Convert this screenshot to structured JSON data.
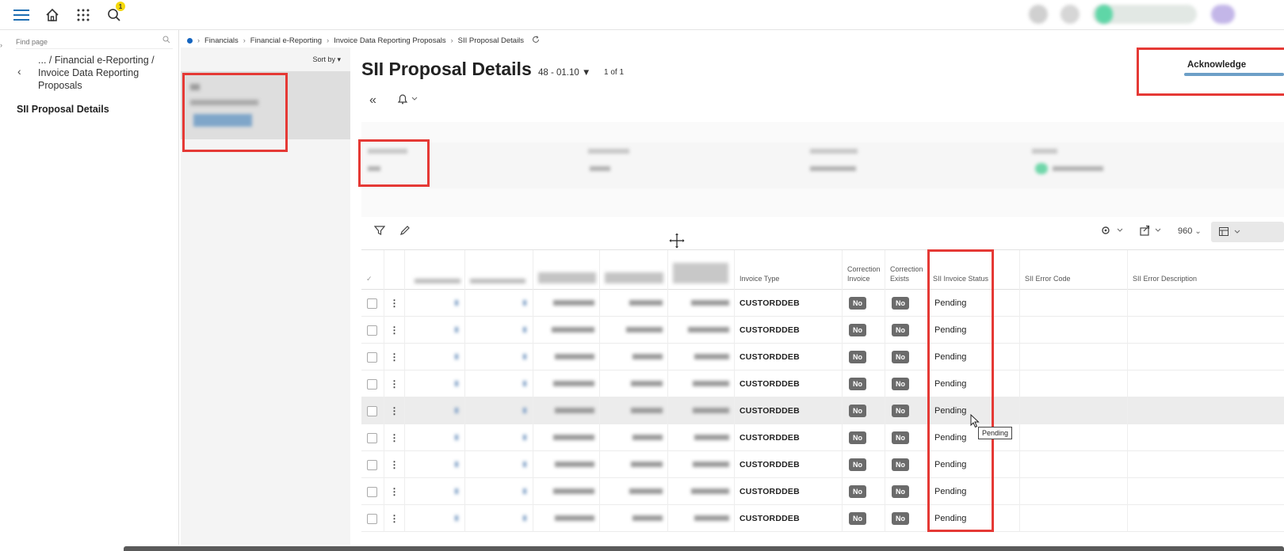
{
  "topbar": {
    "notification_count": "1"
  },
  "leftnav": {
    "find_placeholder": "Find page",
    "path": "... / Financial e-Reporting / Invoice Data Reporting Proposals",
    "current": "SII Proposal Details"
  },
  "breadcrumb": [
    "Financials",
    "Financial e-Reporting",
    "Invoice Data Reporting Proposals",
    "SII Proposal Details"
  ],
  "list": {
    "sort_label": "Sort by"
  },
  "header": {
    "title": "SII Proposal Details",
    "record_selector": "48 - 01.10",
    "record_count": "1 of 1",
    "acknowledge_label": "Acknowledge"
  },
  "toolbar": {
    "page_size": "960"
  },
  "table": {
    "columns": {
      "invoice_type": "Invoice Type",
      "correction_invoice": "Correction Invoice",
      "correction_exists": "Correction Exists",
      "sii_invoice_status": "SII Invoice Status",
      "sii_error_code": "SII Error Code",
      "sii_error_description": "SII Error Description"
    },
    "rows": [
      {
        "invoice_type": "CUSTORDDEB",
        "correction_invoice": "No",
        "correction_exists": "No",
        "status": "Pending"
      },
      {
        "invoice_type": "CUSTORDDEB",
        "correction_invoice": "No",
        "correction_exists": "No",
        "status": "Pending"
      },
      {
        "invoice_type": "CUSTORDDEB",
        "correction_invoice": "No",
        "correction_exists": "No",
        "status": "Pending"
      },
      {
        "invoice_type": "CUSTORDDEB",
        "correction_invoice": "No",
        "correction_exists": "No",
        "status": "Pending"
      },
      {
        "invoice_type": "CUSTORDDEB",
        "correction_invoice": "No",
        "correction_exists": "No",
        "status": "Pending"
      },
      {
        "invoice_type": "CUSTORDDEB",
        "correction_invoice": "No",
        "correction_exists": "No",
        "status": "Pending"
      },
      {
        "invoice_type": "CUSTORDDEB",
        "correction_invoice": "No",
        "correction_exists": "No",
        "status": "Pending"
      },
      {
        "invoice_type": "CUSTORDDEB",
        "correction_invoice": "No",
        "correction_exists": "No",
        "status": "Pending"
      },
      {
        "invoice_type": "CUSTORDDEB",
        "correction_invoice": "No",
        "correction_exists": "No",
        "status": "Pending"
      }
    ]
  },
  "tooltip": "Pending"
}
